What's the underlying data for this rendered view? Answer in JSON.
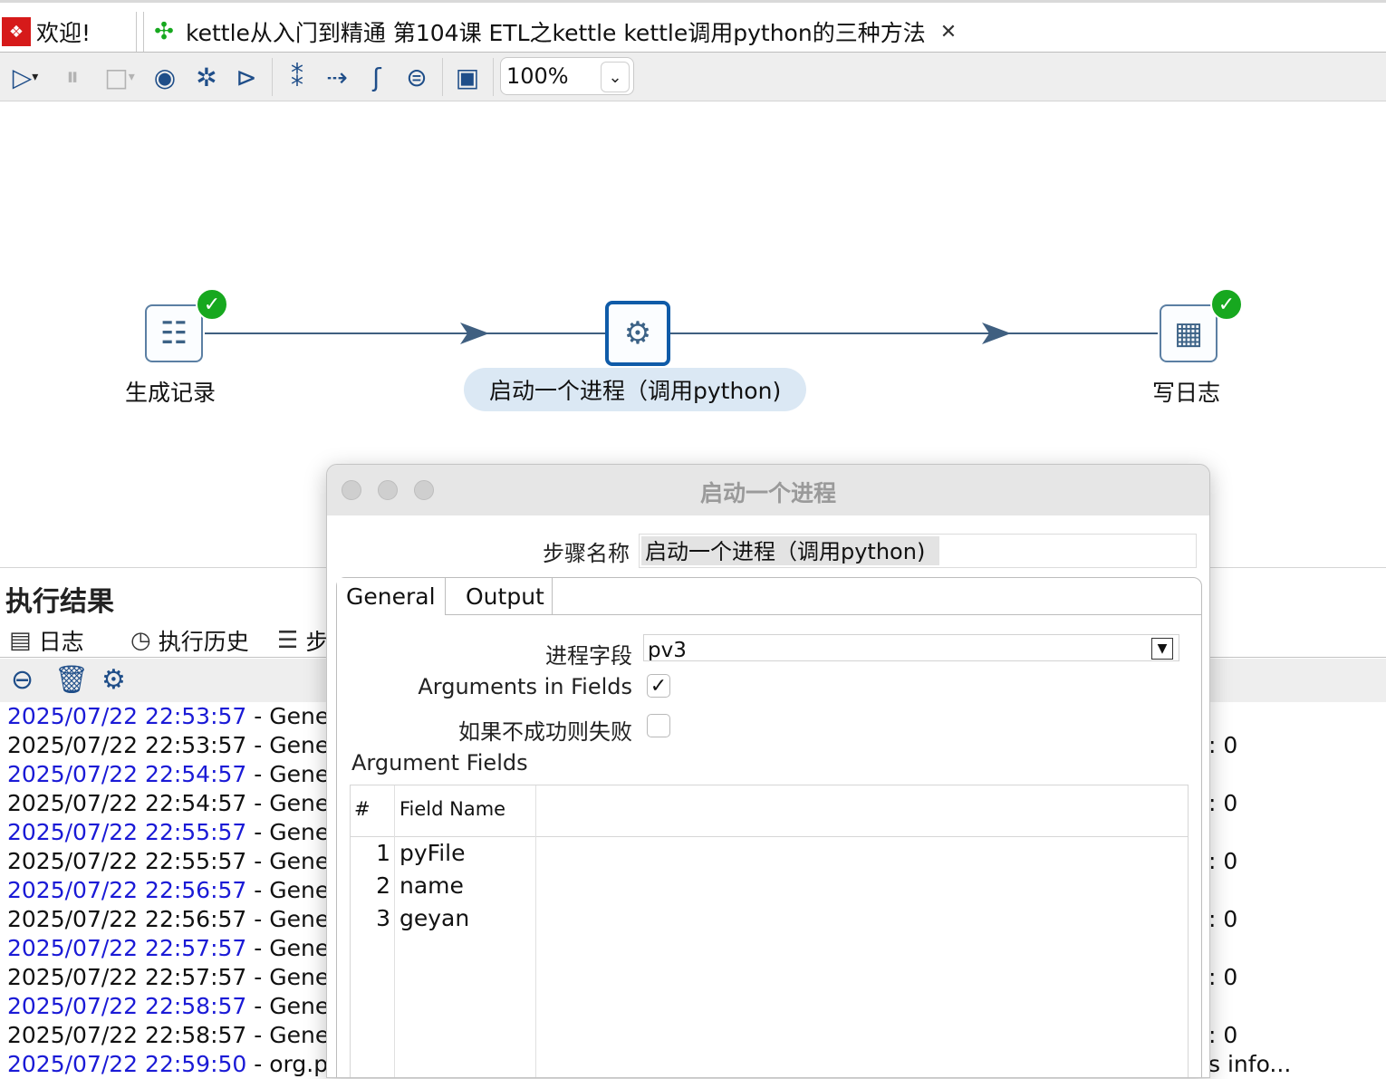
{
  "tabs": {
    "welcome": "欢迎!",
    "main": "kettle从入门到精通 第104课 ETL之kettle kettle调用python的三种方法"
  },
  "toolbar": {
    "zoom": "100%"
  },
  "canvas": {
    "steps": [
      {
        "label": "生成记录",
        "icon": "generate-rows-icon",
        "status": "success"
      },
      {
        "label": "启动一个进程（调用python)",
        "icon": "execute-process-icon",
        "status": "selected"
      },
      {
        "label": "写日志",
        "icon": "write-log-icon",
        "status": "success"
      }
    ]
  },
  "results": {
    "title": "执行结果",
    "tabs": [
      "日志",
      "执行历史",
      "步"
    ],
    "log_lines": [
      {
        "ts": "2025/07/22 22:53:57",
        "text": " - Gener"
      },
      {
        "ts": "2025/07/22 22:53:57",
        "text": " - Gener"
      },
      {
        "ts": "2025/07/22 22:54:57",
        "text": " - Gener"
      },
      {
        "ts": "2025/07/22 22:54:57",
        "text": " - Gener"
      },
      {
        "ts": "2025/07/22 22:55:57",
        "text": " - Gener"
      },
      {
        "ts": "2025/07/22 22:55:57",
        "text": " - Gener"
      },
      {
        "ts": "2025/07/22 22:56:57",
        "text": " - Gener"
      },
      {
        "ts": "2025/07/22 22:56:57",
        "text": " - Gener"
      },
      {
        "ts": "2025/07/22 22:57:57",
        "text": " - Gener"
      },
      {
        "ts": "2025/07/22 22:57:57",
        "text": " - Gener"
      },
      {
        "ts": "2025/07/22 22:58:57",
        "text": " - Gener"
      },
      {
        "ts": "2025/07/22 22:58:57",
        "text": " - Gener"
      },
      {
        "ts": "2025/07/22 22:59:50",
        "text": " - org.p"
      }
    ],
    "right_fragments": [
      "",
      ": 0",
      "",
      ": 0",
      "",
      ": 0",
      "",
      ": 0",
      "",
      ": 0",
      "",
      ": 0",
      "s info..."
    ]
  },
  "dialog": {
    "title": "启动一个进程",
    "step_name_label": "步骤名称",
    "step_name_value": "启动一个进程（调用python)",
    "tabs": {
      "general": "General",
      "output": "Output"
    },
    "process_field_label": "进程字段",
    "process_field_value": "pv3",
    "args_in_fields_label": "Arguments in Fields",
    "args_in_fields_checked": true,
    "fail_if_not_success_label": "如果不成功则失败",
    "fail_if_not_success_checked": false,
    "argument_fields_title": "Argument Fields",
    "grid": {
      "headers": {
        "num": "#",
        "field_name": "Field Name"
      },
      "rows": [
        {
          "num": "1",
          "name": "pyFile"
        },
        {
          "num": "2",
          "name": "name"
        },
        {
          "num": "3",
          "name": "geyan"
        }
      ]
    }
  }
}
